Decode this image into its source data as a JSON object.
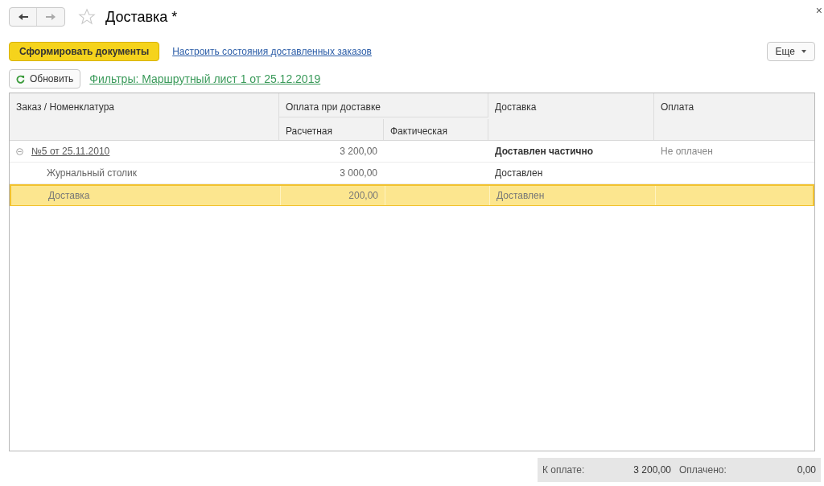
{
  "window": {
    "title": "Доставка *",
    "close": "×"
  },
  "toolbar": {
    "primary_button": "Сформировать документы",
    "link": "Настроить состояния доставленных заказов",
    "more_button": "Еще"
  },
  "filter_bar": {
    "refresh_button": "Обновить",
    "filter_link": "Фильтры: Маршрутный лист 1 от 25.12.2019"
  },
  "table": {
    "columns": {
      "order": "Заказ / Номенклатура",
      "payment_group": "Оплата при доставке",
      "estimated": "Расчетная",
      "actual": "Фактическая",
      "delivery": "Доставка",
      "payment": "Оплата"
    },
    "rows": [
      {
        "kind": "order",
        "name": "№5 от 25.11.2010",
        "expanded": true,
        "estimated": "3 200,00",
        "delivery": "Доставлен частично",
        "payment": "Не оплачен",
        "selected": false
      },
      {
        "kind": "item",
        "name": "Журнальный столик",
        "estimated": "3 000,00",
        "delivery": "Доставлен",
        "selected": false
      },
      {
        "kind": "item",
        "name": "Доставка",
        "estimated": "200,00",
        "delivery": "Доставлен",
        "selected": true
      }
    ]
  },
  "totals": {
    "to_pay_label": "К оплате:",
    "to_pay": "3 200,00",
    "paid_label": "Оплачено:",
    "paid": "0,00"
  }
}
